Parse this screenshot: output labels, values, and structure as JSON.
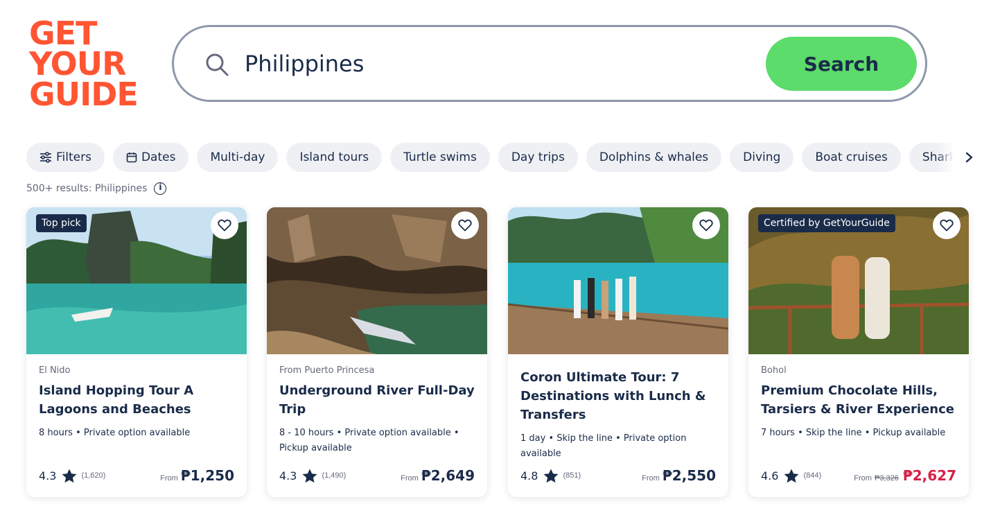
{
  "logo": {
    "line1": "GET",
    "line2": "YOUR",
    "line3": "GUIDE"
  },
  "search": {
    "query": "Philippines",
    "button_label": "Search"
  },
  "chips": [
    {
      "label": "Filters",
      "icon": "sliders-icon"
    },
    {
      "label": "Dates",
      "icon": "calendar-icon"
    },
    {
      "label": "Multi-day"
    },
    {
      "label": "Island tours"
    },
    {
      "label": "Turtle swims"
    },
    {
      "label": "Day trips"
    },
    {
      "label": "Dolphins & whales"
    },
    {
      "label": "Diving"
    },
    {
      "label": "Boat cruises"
    },
    {
      "label": "Shark diving"
    }
  ],
  "results_text": "500+ results: Philippines",
  "colors": {
    "brand": "#ff5533",
    "accent_button": "#5cdc6a",
    "navy": "#1a2b49",
    "sale": "#d61f45"
  },
  "cards": [
    {
      "badge": "Top pick",
      "location": "El Nido",
      "title": "Island Hopping Tour A Lagoons and Beaches",
      "meta": "8 hours • Private option available",
      "rating": "4.3",
      "reviews": "(1,620)",
      "from": "From",
      "old_price": "",
      "price": "₱1,250"
    },
    {
      "badge": "",
      "location": "From Puerto Princesa",
      "title": "Underground River Full-Day Trip",
      "meta": "8 - 10 hours • Private option available • Pickup available",
      "rating": "4.3",
      "reviews": "(1,490)",
      "from": "From",
      "old_price": "",
      "price": "₱2,649"
    },
    {
      "badge": "",
      "location": "",
      "title": "Coron Ultimate Tour: 7 Destinations with Lunch & Transfers",
      "meta": "1 day • Skip the line • Private option available",
      "rating": "4.8",
      "reviews": "(851)",
      "from": "From",
      "old_price": "",
      "price": "₱2,550"
    },
    {
      "badge": "Certified by GetYourGuide",
      "location": "Bohol",
      "title": "Premium Chocolate Hills, Tarsiers & River Experience",
      "meta": "7 hours • Skip the line • Pickup available",
      "rating": "4.6",
      "reviews": "(844)",
      "from": "From",
      "old_price": "₱3,326",
      "price": "₱2,627"
    }
  ]
}
